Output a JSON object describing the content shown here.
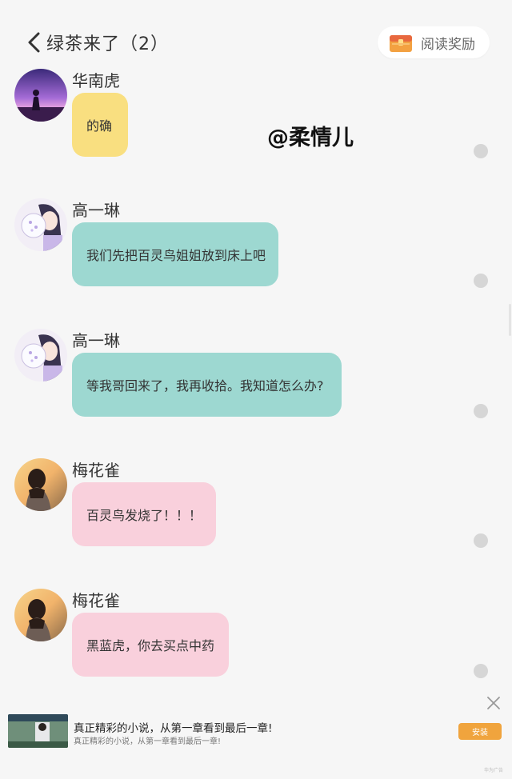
{
  "header": {
    "title": "绿茶来了（2）",
    "reward_label": "阅读奖励"
  },
  "watermark": "@柔情儿",
  "messages": [
    {
      "sender": "华南虎",
      "text": "的确",
      "bubble_color": "#f9df80",
      "avatar": "purple-sunset-silhouette"
    },
    {
      "sender": "高一琳",
      "text": "我们先把百灵鸟姐姐放到床上吧",
      "bubble_color": "#9dd8d1",
      "avatar": "anime-girl-fan"
    },
    {
      "sender": "高一琳",
      "text": "等我哥回来了，我再收拾。我知道怎么办?",
      "bubble_color": "#9dd8d1",
      "avatar": "anime-girl-fan"
    },
    {
      "sender": "梅花雀",
      "text": "百灵鸟发烧了！！！",
      "bubble_color": "#f9d0dc",
      "avatar": "girl-sunset-back"
    },
    {
      "sender": "梅花雀",
      "text": "黑蓝虎，你去买点中药",
      "bubble_color": "#f9d0dc",
      "avatar": "girl-sunset-back"
    }
  ],
  "ad": {
    "title": "真正精彩的小说，从第一章看到最后一章!",
    "subtitle": "真正精彩的小说，从第一章看到最后一章!",
    "install_label": "安装",
    "tag": "华为广告",
    "accent": "#f0a43d"
  }
}
